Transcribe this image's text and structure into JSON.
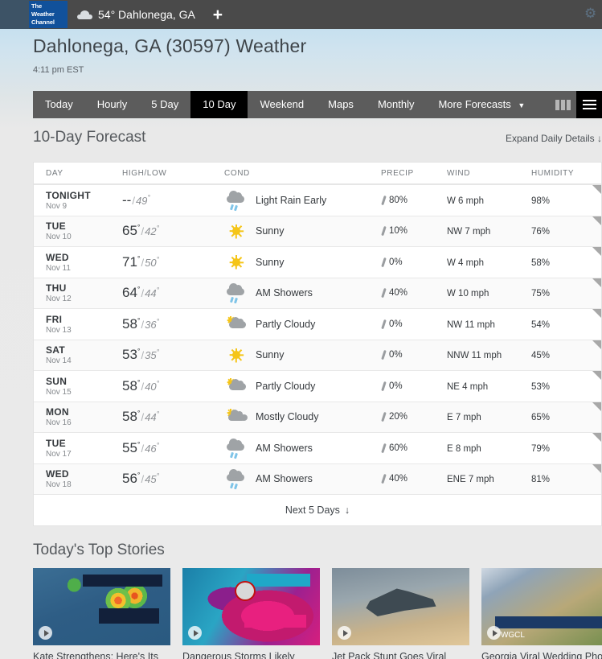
{
  "topbar": {
    "logo_lines": [
      "The",
      "Weather",
      "Channel"
    ],
    "cloud_icon": "cloud-icon",
    "location_chip": "54° Dahlonega, GA",
    "add_label": "+",
    "gear_icon": "gear-icon"
  },
  "header": {
    "page_title": "Dahlonega, GA (30597) Weather",
    "time": "4:11 pm EST"
  },
  "nav": {
    "items": [
      {
        "label": "Today",
        "active": false
      },
      {
        "label": "Hourly",
        "active": false
      },
      {
        "label": "5 Day",
        "active": false
      },
      {
        "label": "10 Day",
        "active": true
      },
      {
        "label": "Weekend",
        "active": false
      },
      {
        "label": "Maps",
        "active": false
      },
      {
        "label": "Monthly",
        "active": false
      },
      {
        "label": "More Forecasts",
        "active": false,
        "caret": "▼"
      }
    ],
    "grid_icon": "grid-icon",
    "menu_icon": "hamburger-menu-icon"
  },
  "forecast": {
    "title": "10-Day Forecast",
    "expand_label": "Expand Daily Details",
    "expand_arrow": "↓",
    "columns": [
      "DAY",
      "HIGH/LOW",
      "COND",
      "PRECIP",
      "WIND",
      "HUMIDITY"
    ],
    "next5_label": "Next 5 Days",
    "next5_arrow": "↓",
    "rows": [
      {
        "day": "TONIGHT",
        "date": "Nov 9",
        "high": "--",
        "low": "49",
        "icon": "rain-cloud-icon",
        "cond": "Light Rain Early",
        "precip": "80%",
        "wind": "W 6 mph",
        "humidity": "98%"
      },
      {
        "day": "TUE",
        "date": "Nov 10",
        "high": "65",
        "low": "42",
        "icon": "sun-icon",
        "cond": "Sunny",
        "precip": "10%",
        "wind": "NW 7 mph",
        "humidity": "76%"
      },
      {
        "day": "WED",
        "date": "Nov 11",
        "high": "71",
        "low": "50",
        "icon": "sun-icon",
        "cond": "Sunny",
        "precip": "0%",
        "wind": "W 4 mph",
        "humidity": "58%"
      },
      {
        "day": "THU",
        "date": "Nov 12",
        "high": "64",
        "low": "44",
        "icon": "rain-cloud-icon",
        "cond": "AM Showers",
        "precip": "40%",
        "wind": "W 10 mph",
        "humidity": "75%"
      },
      {
        "day": "FRI",
        "date": "Nov 13",
        "high": "58",
        "low": "36",
        "icon": "partly-cloudy-icon",
        "cond": "Partly Cloudy",
        "precip": "0%",
        "wind": "NW 11 mph",
        "humidity": "54%"
      },
      {
        "day": "SAT",
        "date": "Nov 14",
        "high": "53",
        "low": "35",
        "icon": "sun-icon",
        "cond": "Sunny",
        "precip": "0%",
        "wind": "NNW 11 mph",
        "humidity": "45%"
      },
      {
        "day": "SUN",
        "date": "Nov 15",
        "high": "58",
        "low": "40",
        "icon": "partly-cloudy-icon",
        "cond": "Partly Cloudy",
        "precip": "0%",
        "wind": "NE 4 mph",
        "humidity": "53%"
      },
      {
        "day": "MON",
        "date": "Nov 16",
        "high": "58",
        "low": "44",
        "icon": "mostly-cloudy-icon",
        "cond": "Mostly Cloudy",
        "precip": "20%",
        "wind": "E 7 mph",
        "humidity": "65%"
      },
      {
        "day": "TUE",
        "date": "Nov 17",
        "high": "55",
        "low": "46",
        "icon": "rain-cloud-icon",
        "cond": "AM Showers",
        "precip": "60%",
        "wind": "E 8 mph",
        "humidity": "79%"
      },
      {
        "day": "WED",
        "date": "Nov 18",
        "high": "56",
        "low": "45",
        "icon": "rain-cloud-icon",
        "cond": "AM Showers",
        "precip": "40%",
        "wind": "ENE 7 mph",
        "humidity": "81%"
      }
    ]
  },
  "stories": {
    "title": "Today's Top Stories",
    "items": [
      {
        "title": "Kate Strengthens; Here's Its",
        "thumb_class": "th1",
        "overlay": ""
      },
      {
        "title": "Dangerous Storms Likely",
        "thumb_class": "th2",
        "overlay": ""
      },
      {
        "title": "Jet Pack Stunt Goes Viral",
        "thumb_class": "th3",
        "overlay": ""
      },
      {
        "title": "Georgia Viral Wedding Photo",
        "thumb_class": "th4",
        "overlay": "WGCL"
      }
    ]
  },
  "colors": {
    "brand_blue": "#11519b",
    "topbar": "#3d5366",
    "nav_bg": "#5c5c5c",
    "nav_active": "#000000",
    "sun_yellow": "#f5c518",
    "cloud_gray": "#9fa3a6",
    "rain_blue": "#7fc4e8"
  }
}
